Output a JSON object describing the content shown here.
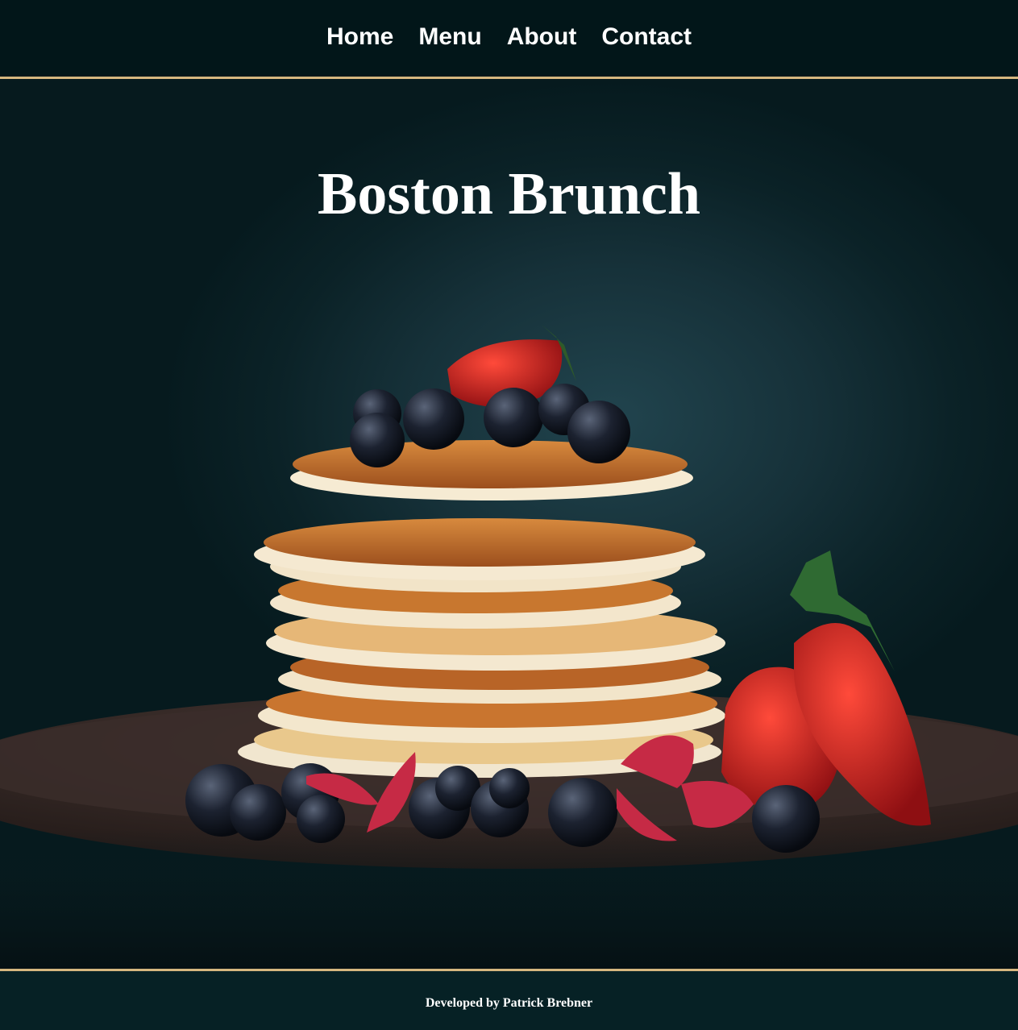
{
  "nav": {
    "items": [
      {
        "label": "Home"
      },
      {
        "label": "Menu"
      },
      {
        "label": "About"
      },
      {
        "label": "Contact"
      }
    ]
  },
  "hero": {
    "title": "Boston Brunch",
    "image_subject": "stack of pancakes with blueberries, strawberries and flower petals on a dark plate"
  },
  "footer": {
    "credit": "Developed by Patrick Brebner"
  },
  "colors": {
    "background": "#031b1f",
    "accent_border": "#d6b77f",
    "text": "#ffffff"
  }
}
